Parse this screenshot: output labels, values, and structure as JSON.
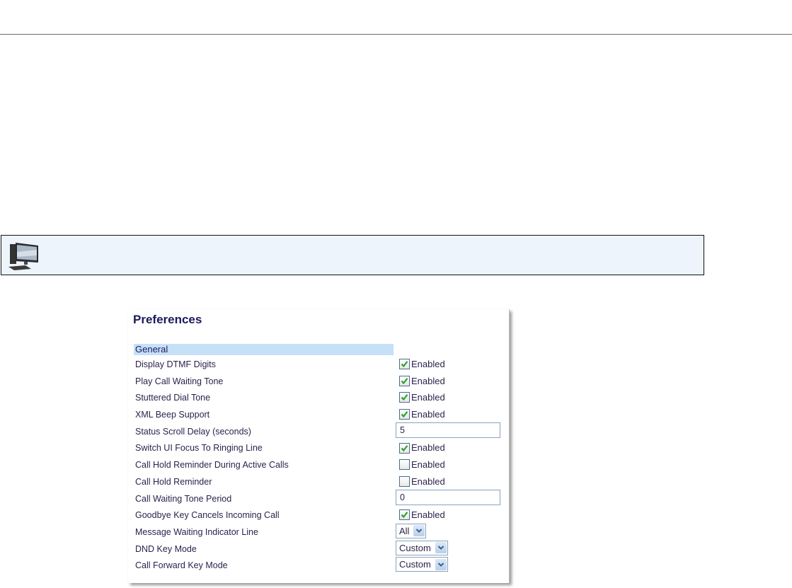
{
  "panel": {
    "title": "Preferences",
    "section": "General",
    "enabled_label": "Enabled",
    "rows": [
      {
        "label": "Display DTMF Digits",
        "type": "checkbox",
        "checked": true
      },
      {
        "label": "Play Call Waiting Tone",
        "type": "checkbox",
        "checked": true
      },
      {
        "label": "Stuttered Dial Tone",
        "type": "checkbox",
        "checked": true
      },
      {
        "label": "XML Beep Support",
        "type": "checkbox",
        "checked": true
      },
      {
        "label": "Status Scroll Delay (seconds)",
        "type": "text",
        "value": "5"
      },
      {
        "label": "Switch UI Focus To Ringing Line",
        "type": "checkbox",
        "checked": true
      },
      {
        "label": "Call Hold Reminder During Active Calls",
        "type": "checkbox",
        "checked": false
      },
      {
        "label": "Call Hold Reminder",
        "type": "checkbox",
        "checked": false
      },
      {
        "label": "Call Waiting Tone Period",
        "type": "text",
        "value": "0"
      },
      {
        "label": "Goodbye Key Cancels Incoming Call",
        "type": "checkbox",
        "checked": true
      },
      {
        "label": "Message Waiting Indicator Line",
        "type": "select",
        "value": "All"
      },
      {
        "label": "DND Key Mode",
        "type": "select",
        "value": "Custom"
      },
      {
        "label": "Call Forward Key Mode",
        "type": "select",
        "value": "Custom"
      }
    ]
  },
  "colors": {
    "check": "#2aa52a",
    "title": "#1a1a5e",
    "section_bg": "#c6e0f7"
  }
}
